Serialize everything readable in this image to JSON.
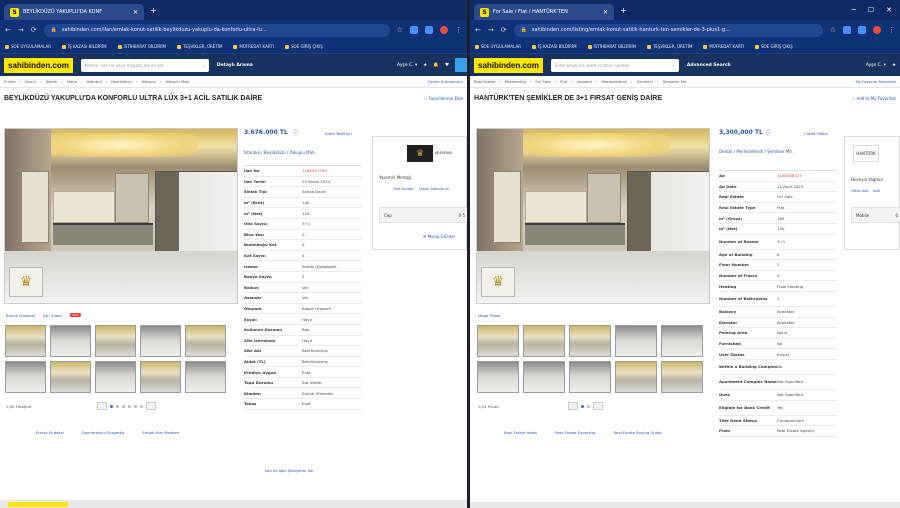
{
  "left": {
    "tab_title": "BEYLİKDÜZÜ YAKUPLU'DA KONF",
    "url": "sahibinden.com/ilan/emlak-konut-satilik-beylikduzu-yakuplu-da-konforlu-ultra-lu...",
    "bookmarks": [
      "SOE UYGULAMALAR",
      "İŞ KAZASI BİLDİRİM",
      "İSTİHBARAT BİLDİRİM",
      "TEŞVİKLER, ÜRETİM",
      "MÜFREDAT KARTI",
      "SOE GİRİŞ ÇIKIŞ"
    ],
    "logo": "sahibinden.com",
    "search_placeholder": "Kelime, ilan no veya mağaza adı ile ara",
    "adv_search": "Detaylı Arama",
    "user": "Ayşe C. ▾",
    "crumbs": [
      "Emlak",
      "Konut",
      "Satılık",
      "Daire",
      "İstanbul",
      "Beylikdüzü",
      "Yakuplu",
      "Yakuplu Mah."
    ],
    "crumb_right": "Favori Aramalarım",
    "title": "BEYLİKDÜZÜ YAKUPLU'DA KONFORLU ULTRA LÜX 3+1 ACİL SATILIK DAİRE",
    "fav_link": "☆ Favorilerime Ekle",
    "photo_actions": [
      "Büyük Fotoğraf",
      "İlan Video"
    ],
    "new_badge": "YENİ",
    "pager_label": "1/40 Fotoğraf",
    "bottom_links": [
      "Emlak Endeksi",
      "Gayrimenkul Ekspertiz",
      "Emlak Alım Rehberi"
    ],
    "price": "3.676.000 TL",
    "price_help": "Kredi Teklifleri",
    "location": "İstanbul / Beylikdüzü / Yakuplu Mah.",
    "attributes": [
      {
        "k": "İlan No",
        "v": "1164547759",
        "red": true
      },
      {
        "k": "İlan Tarihi",
        "v": "25 Nisan 2024"
      },
      {
        "k": "Emlak Tipi",
        "v": "Satılık Daire"
      },
      {
        "k": "m² (Brüt)",
        "v": "140"
      },
      {
        "k": "m² (Net)",
        "v": "120"
      },
      {
        "k": "Oda Sayısı",
        "v": "3+1"
      },
      {
        "k": "Bina Yaşı",
        "v": "0"
      },
      {
        "k": "Bulunduğu Kat",
        "v": "0"
      },
      {
        "k": "Kat Sayısı",
        "v": "4"
      },
      {
        "k": "Isıtma",
        "v": "Kombi (Doğalgaz)"
      },
      {
        "k": "Banyo Sayısı",
        "v": "2"
      },
      {
        "k": "Balkon",
        "v": "Var"
      },
      {
        "k": "Asansör",
        "v": "Var"
      },
      {
        "k": "Otopark",
        "v": "Kapalı Otopark"
      },
      {
        "k": "Eşyalı",
        "v": "Hayır"
      },
      {
        "k": "Kullanım Durumu",
        "v": "Boş"
      },
      {
        "k": "Site İçerisinde",
        "v": "Hayır"
      },
      {
        "k": "Site Adı",
        "v": "Belirtilmemiş"
      },
      {
        "k": "Aidat (TL)",
        "v": "Belirtilmemiş"
      },
      {
        "k": "Krediye Uygun",
        "v": "Evet"
      },
      {
        "k": "Tapu Durumu",
        "v": "Kat İrtifakı"
      },
      {
        "k": "Kimden",
        "v": "Emlak Ofisinden"
      },
      {
        "k": "Takas",
        "v": "Evet"
      }
    ],
    "report": "İlan ile İlgili Şikayetim Var",
    "seller_name": "Yasemin Mertoğ",
    "seller_links": [
      "Tüm İlanları",
      "Favori Satıcılarım"
    ],
    "seller_chip": "Cep",
    "seller_chip_val": "0 5",
    "seller_msg": "Mesaj Gönder",
    "seller_logo_label": "KREMYAPI"
  },
  "right": {
    "tab_title": "For Sale / Flat / HANTÜRK'TEN",
    "url": "sahibinden.com/listing/emlak-konut-satilik-hanturk-ten-semikler-de-3-plus1-g...",
    "bookmarks": [
      "SOE UYGULAMALAR",
      "İŞ KAZASI BİLDİRİM",
      "İSTİHBARAT BİLDİRİM",
      "TEŞVİKLER, ÜRETİM",
      "MÜFREDAT KARTI",
      "SOE GİRİŞ ÇIKIŞ"
    ],
    "logo": "sahibinden.com",
    "search_placeholder": "Enter keyword, word or store number",
    "adv_search": "Advanced Search",
    "user": "Ayşe C. ▾",
    "crumbs": [
      "Real Estate",
      "Residential",
      "For Sale",
      "Flat",
      "İstanbul",
      "Merkezefendi",
      "Şemikler",
      "Şemikler Mh."
    ],
    "crumb_right": "My Favorite Searches",
    "title": "HANTÜRK'TEN ŞEMİKLER DE 3+1 FIRSAT GENİŞ DAİRE",
    "fav_link": "☆ Add to My Favorites",
    "photo_actions": [
      "Mega Photo"
    ],
    "pager_label": "1/14 Photo",
    "bottom_links": [
      "Real Estate Index",
      "Real Estate Expertise",
      "Real Estate Buying Guide"
    ],
    "price": "3,300,000 TL",
    "price_help": "Credit Offers",
    "location": "Denizli / Merkezefendi / Şemikler Mh.",
    "attributes": [
      {
        "k": "Ad",
        "v": "1158788727",
        "red": true
      },
      {
        "k": "Ad Date",
        "v": "12 April 2024"
      },
      {
        "k": "Real Estate",
        "v": "For Sale"
      },
      {
        "k": "Real Estate Type",
        "v": "Flat"
      },
      {
        "k": "m² (Gross)",
        "v": "165"
      },
      {
        "k": "m² (Net)",
        "v": "140"
      },
      {
        "k": "Number of Rooms",
        "v": "3+1",
        "tall": true
      },
      {
        "k": "Age of Building",
        "v": "0"
      },
      {
        "k": "Floor Number",
        "v": "2"
      },
      {
        "k": "Number of Floors",
        "v": "5"
      },
      {
        "k": "Heating",
        "v": "Floor Heating"
      },
      {
        "k": "Number of Bathrooms",
        "v": "2",
        "tall": true
      },
      {
        "k": "Balcony",
        "v": "Available"
      },
      {
        "k": "Elevator",
        "v": "Available"
      },
      {
        "k": "Parking Area",
        "v": "None"
      },
      {
        "k": "Furnished",
        "v": "No"
      },
      {
        "k": "User Status",
        "v": "Empty"
      },
      {
        "k": "Within a Building Complex",
        "v": "No",
        "tall": true
      },
      {
        "k": "Apartment Complex Name",
        "v": "Not Specified",
        "tall": true
      },
      {
        "k": "Dues",
        "v": "Not Specified"
      },
      {
        "k": "Eligible for Bank Credit",
        "v": "Yes",
        "tall": true
      },
      {
        "k": "Title Deed Status",
        "v": "Condominium"
      },
      {
        "k": "From",
        "v": "Real Estate Agency"
      }
    ],
    "seller_name": "Hüseyin Yağmur",
    "seller_links": [
      "Other Ads",
      "Add"
    ],
    "seller_chip": "Mobile",
    "seller_chip_val": "0",
    "seller_logo_label": "HANTÜRK"
  }
}
